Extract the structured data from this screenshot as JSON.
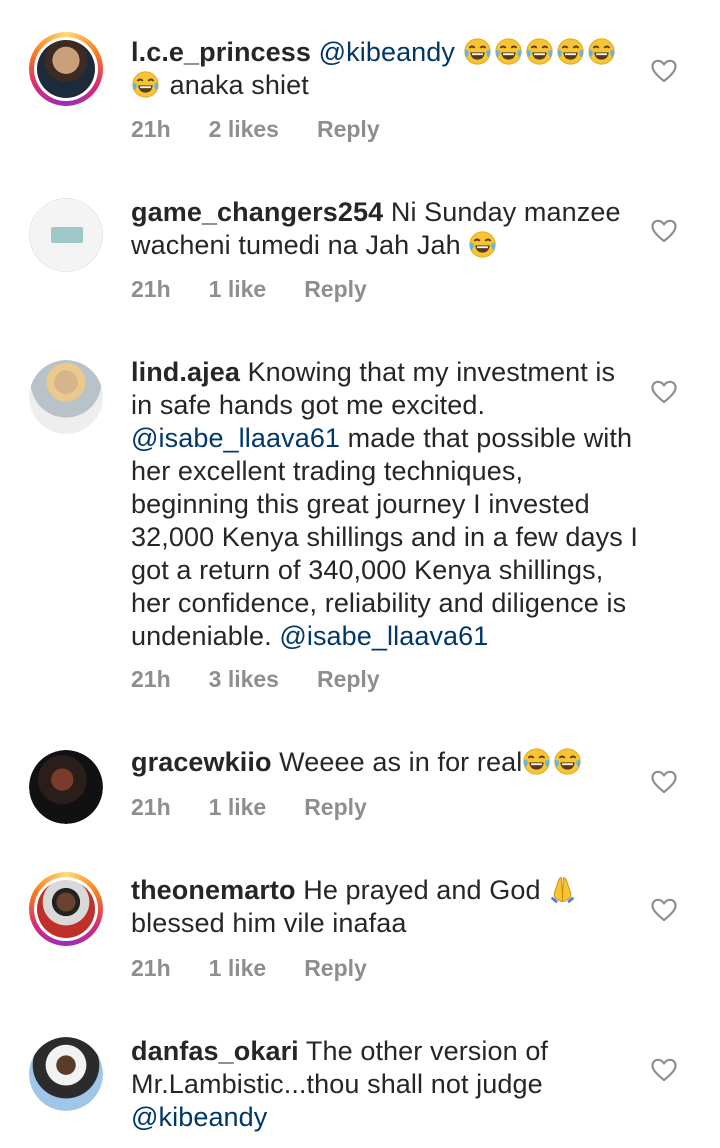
{
  "comments": [
    {
      "username": "l.c.e_princess",
      "mention": "@kibeandy",
      "text_after_emoji": "anaka shiet",
      "time": "21h",
      "likes": "2 likes",
      "reply": "Reply"
    },
    {
      "username": "game_changers254",
      "text": "Ni Sunday manzee wacheni tumedi na Jah Jah",
      "time": "21h",
      "likes": "1 like",
      "reply": "Reply"
    },
    {
      "username": "lind.ajea",
      "text_1": "Knowing that my investment is in safe hands got me excited.",
      "mention_1": "@isabe_llaava61",
      "text_2": "made that possible with her excellent trading techniques, beginning this great journey I invested 32,000 Kenya shillings and in a few days I got a return of 340,000 Kenya shillings, her confidence, reliability and diligence is undeniable.",
      "mention_2": "@isabe_llaava61",
      "time": "21h",
      "likes": "3 likes",
      "reply": "Reply"
    },
    {
      "username": "gracewkiio",
      "text": "Weeee as in for real",
      "time": "21h",
      "likes": "1 like",
      "reply": "Reply"
    },
    {
      "username": "theonemarto",
      "text_1": "He prayed and God",
      "text_2": "blessed him vile inafaa",
      "time": "21h",
      "likes": "1 like",
      "reply": "Reply"
    },
    {
      "username": "danfas_okari",
      "text": "The other version of Mr.Lambistic...thou shall not judge",
      "mention": "@kibeandy"
    }
  ],
  "icons": {
    "heart": "heart-outline-icon",
    "laugh": "face-with-tears-of-joy-icon",
    "pray": "folded-hands-icon"
  },
  "colors": {
    "mention": "#00376b",
    "meta": "#8e8e8e",
    "text": "#262626"
  }
}
